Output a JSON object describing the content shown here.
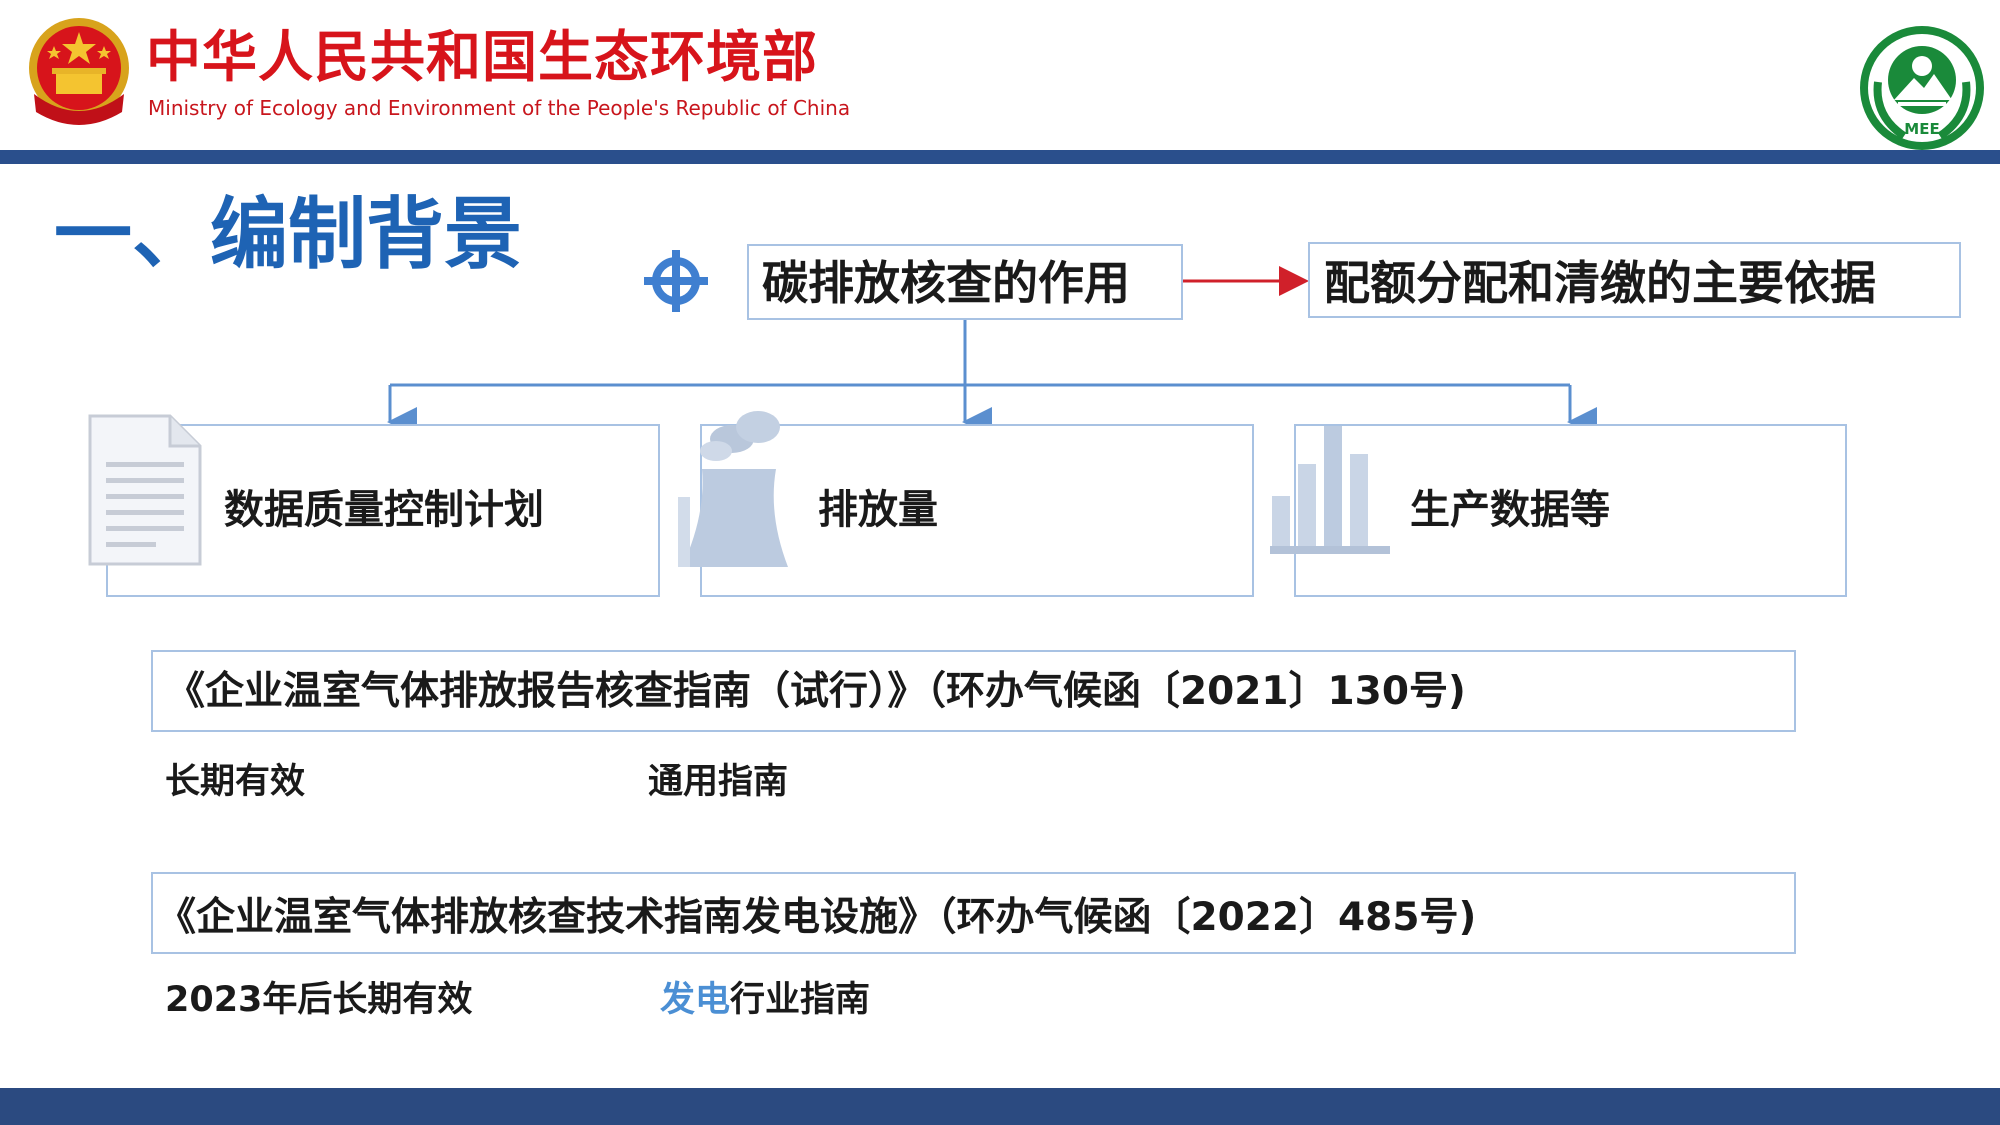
{
  "header": {
    "cn_title": "中华人民共和国生态环境部",
    "en_title": "Ministry of Ecology and Environment of the People's Republic of China",
    "emblem_icon": "national-emblem-icon",
    "logo_icon": "mee-logo-icon",
    "logo_text": "MEE"
  },
  "section": {
    "title": "一、编制背景"
  },
  "diagram": {
    "role": "碳排放核查的作用",
    "basis": "配额分配和清缴的主要依据",
    "items": [
      {
        "label": "数据质量控制计划",
        "icon": "document-icon"
      },
      {
        "label": "排放量",
        "icon": "power-plant-icon"
      },
      {
        "label": "生产数据等",
        "icon": "bar-chart-icon"
      }
    ]
  },
  "guides": [
    {
      "title": "《企业温室气体排放报告核查指南（试行）》（环办气候函〔2021〕130号)",
      "note_left": "长期有效",
      "note_right": "通用指南"
    },
    {
      "title": "《企业温室气体排放核查技术指南发电设施》（环办气候函〔2022〕485号)",
      "note_left": "2023年后长期有效",
      "note_right_accent": "发电",
      "note_right_rest": "行业指南"
    }
  ],
  "colors": {
    "brand_red": "#d7141b",
    "heading_blue": "#1e63b4",
    "bar_navy": "#2a4f8c",
    "box_border": "#a8c2e3",
    "accent_blue": "#4b8fd4",
    "arrow_red": "#d0202a",
    "connector_blue": "#5b8fcf"
  }
}
